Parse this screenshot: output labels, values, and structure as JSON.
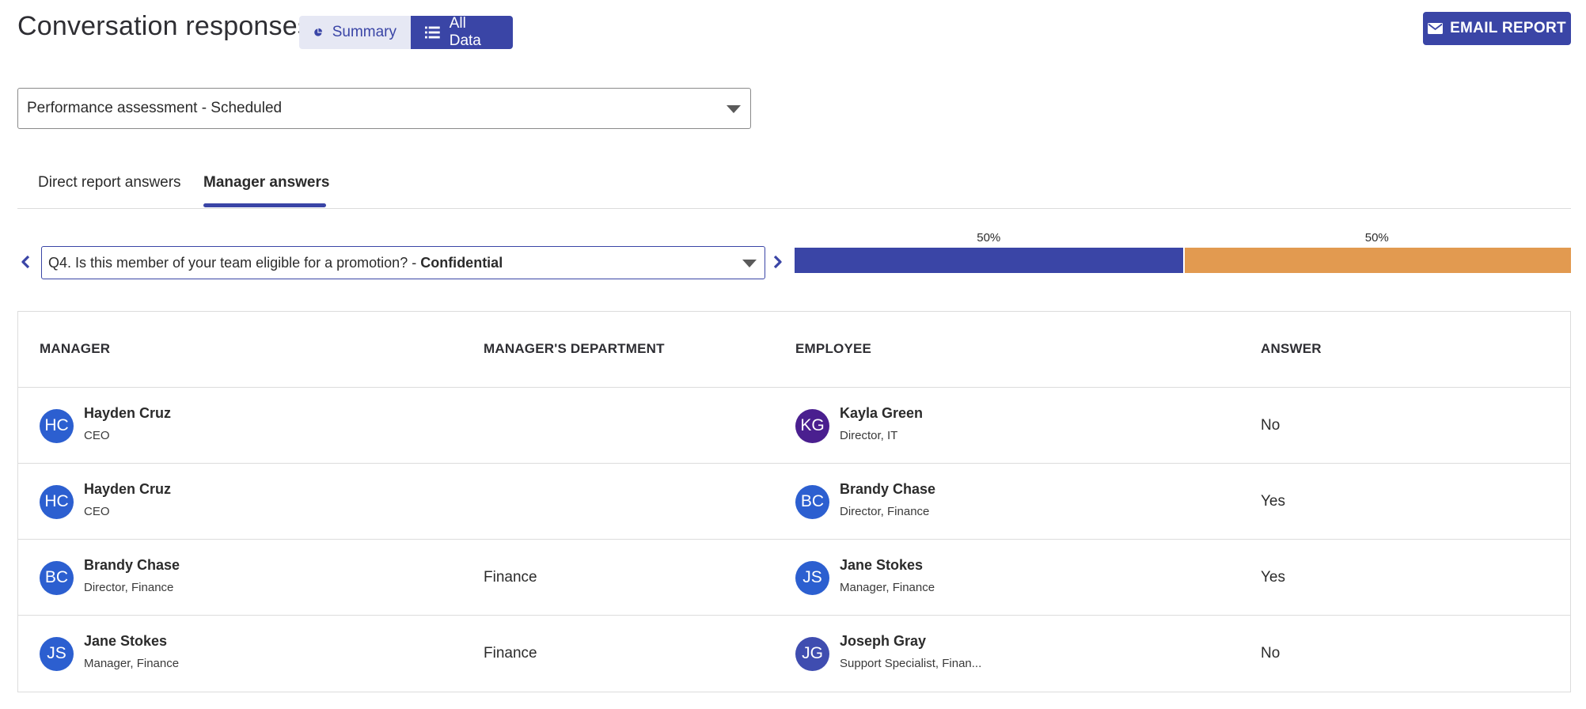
{
  "header": {
    "title": "Conversation responses",
    "view_toggle": {
      "summary_label": "Summary",
      "all_data_label": "All Data",
      "active": "All Data"
    },
    "email_report_label": "EMAIL REPORT"
  },
  "survey_select": {
    "value": "Performance assessment - Scheduled"
  },
  "tabs": [
    {
      "label": "Direct report answers",
      "active": false
    },
    {
      "label": "Manager answers",
      "active": true
    }
  ],
  "question": {
    "text": "Q4. Is this member of your team eligible for a promotion? - ",
    "suffix": "Confidential"
  },
  "answer_distribution": {
    "segments": [
      {
        "label": "50%",
        "fraction": 0.5,
        "color": "#3a45a6"
      },
      {
        "label": "50%",
        "fraction": 0.5,
        "color": "#e29a50"
      }
    ]
  },
  "table": {
    "columns": [
      "MANAGER",
      "MANAGER'S DEPARTMENT",
      "EMPLOYEE",
      "ANSWER"
    ],
    "rows": [
      {
        "manager": {
          "initials": "HC",
          "name": "Hayden Cruz",
          "title": "CEO",
          "color": "#2c5fd0"
        },
        "department": "",
        "employee": {
          "initials": "KG",
          "name": "Kayla Green",
          "title": "Director, IT",
          "color": "#4a1f8f"
        },
        "answer": "No"
      },
      {
        "manager": {
          "initials": "HC",
          "name": "Hayden Cruz",
          "title": "CEO",
          "color": "#2c5fd0"
        },
        "department": "",
        "employee": {
          "initials": "BC",
          "name": "Brandy Chase",
          "title": "Director, Finance",
          "color": "#2c5fd0"
        },
        "answer": "Yes"
      },
      {
        "manager": {
          "initials": "BC",
          "name": "Brandy Chase",
          "title": "Director, Finance",
          "color": "#2c5fd0"
        },
        "department": "Finance",
        "employee": {
          "initials": "JS",
          "name": "Jane Stokes",
          "title": "Manager, Finance",
          "color": "#2c5fd0"
        },
        "answer": "Yes"
      },
      {
        "manager": {
          "initials": "JS",
          "name": "Jane Stokes",
          "title": "Manager, Finance",
          "color": "#2c5fd0"
        },
        "department": "Finance",
        "employee": {
          "initials": "JG",
          "name": "Joseph Gray",
          "title": "Support Specialist, Finan...",
          "color": "#3f4db0"
        },
        "answer": "No"
      }
    ]
  },
  "icons": {
    "summary": "pie-chart-icon",
    "all_data": "list-icon",
    "email": "envelope-icon",
    "prev": "chevron-left-icon",
    "next": "chevron-right-icon",
    "dropdown": "caret-down-icon"
  },
  "colors": {
    "accent": "#3a45a6",
    "secondary": "#e29a50"
  }
}
